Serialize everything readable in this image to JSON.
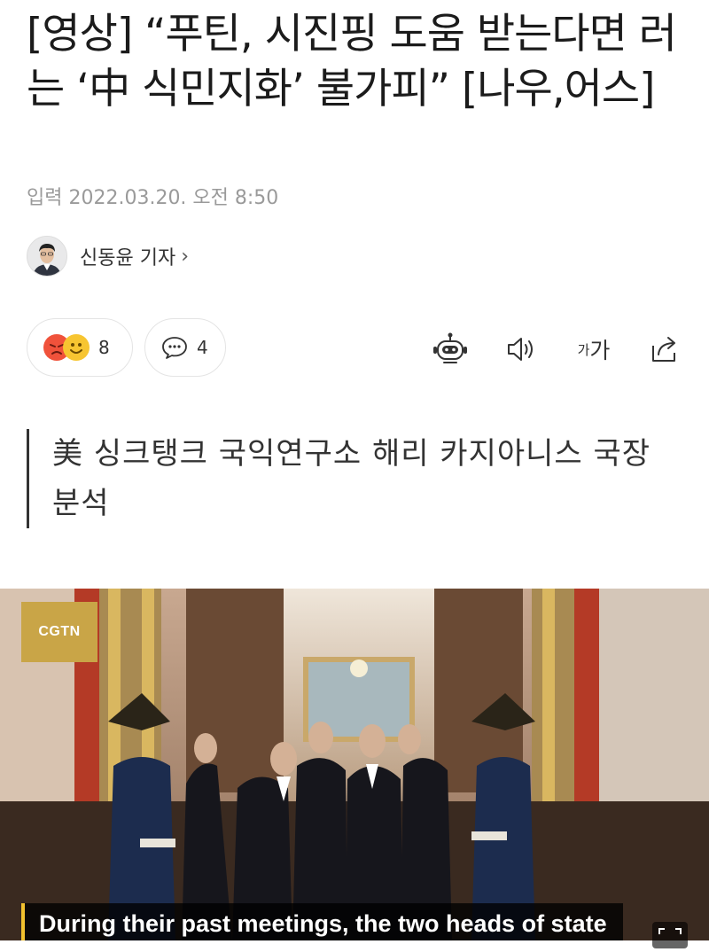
{
  "article": {
    "headline": "[영상] “푸틴, 시진핑 도움 받는다면 러는 ‘中 식민지화’ 불가피” [나우,어스]",
    "date": "입력 2022.03.20. 오전 8:50",
    "reporter": "신동윤 기자",
    "reporter_chevron": "›",
    "subhead": "美 싱크탱크 국익연구소 해리 카지아니스 국장 분석"
  },
  "actions": {
    "reaction_count": "8",
    "comment_count": "4",
    "font_size_label_small": "가",
    "font_size_label_large": "가"
  },
  "video": {
    "watermark": "CGTN",
    "caption": "During their past meetings, the two heads of state"
  },
  "icons": [
    "angry-emoji-icon",
    "smile-emoji-icon",
    "comment-icon",
    "robot-icon",
    "speaker-icon",
    "font-size-icon",
    "share-icon",
    "expand-icon"
  ],
  "colors": {
    "angry": "#f0523b",
    "smile": "#f7c531",
    "caption_accent": "#f2c12e",
    "cgtn_bg": "#c9a547"
  }
}
